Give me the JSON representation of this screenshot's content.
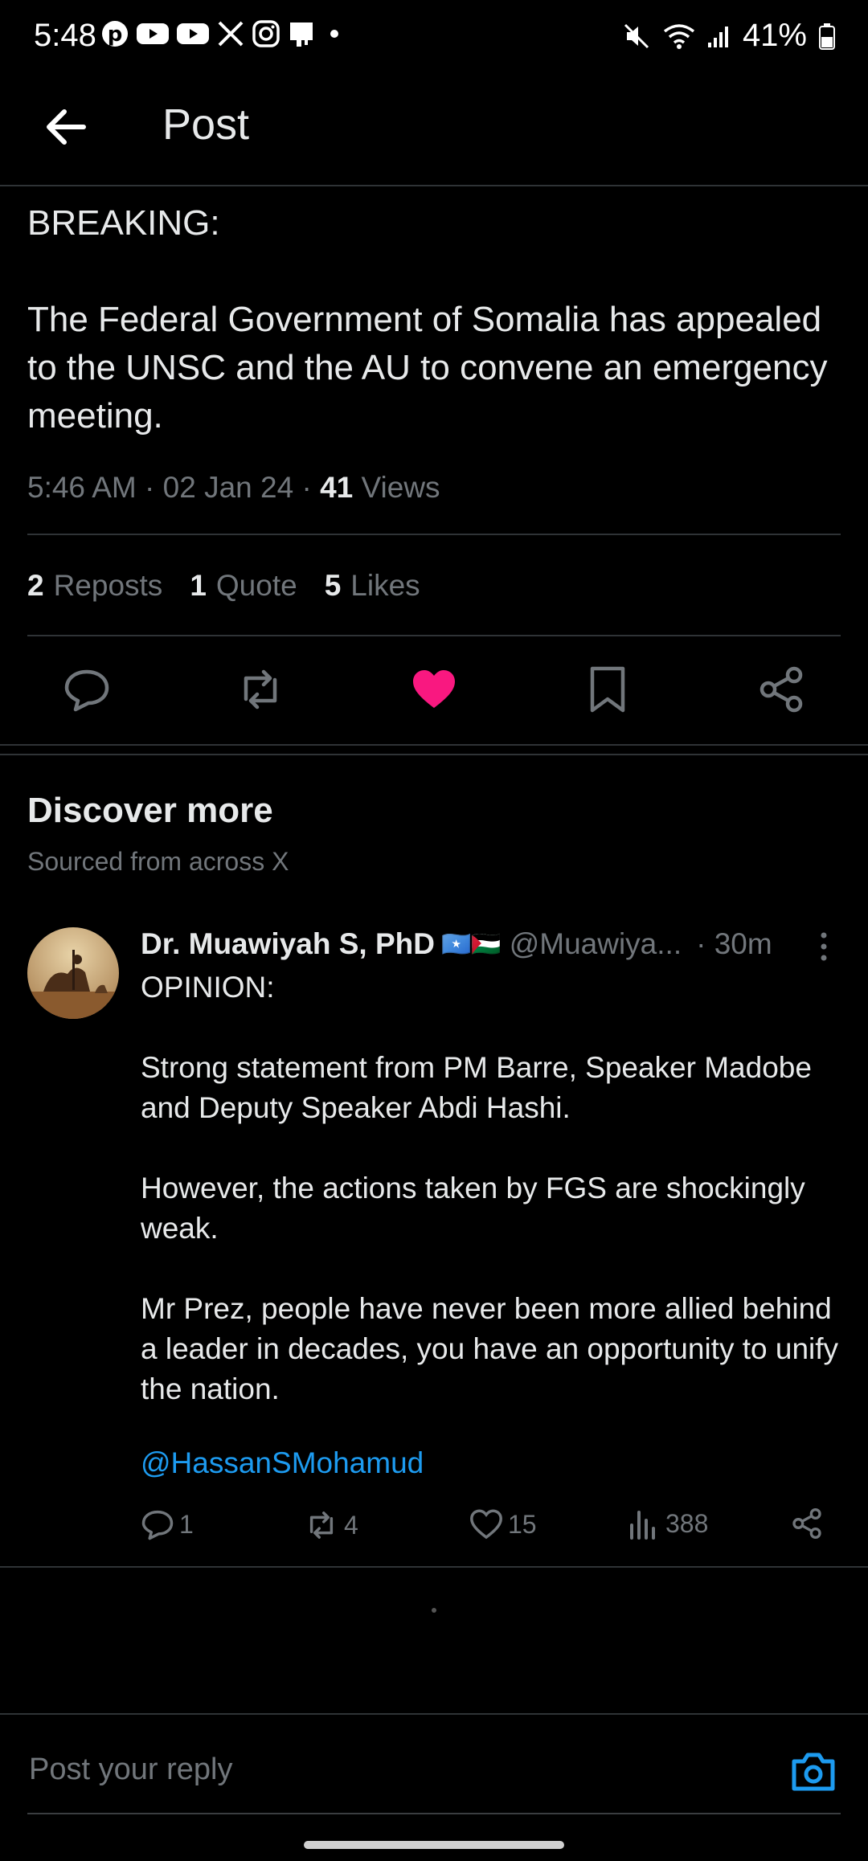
{
  "status_bar": {
    "time": "5:48",
    "battery": "41%",
    "app_icons": [
      "pinterest-icon",
      "youtube-icon",
      "youtube-icon",
      "x-icon",
      "instagram-icon",
      "screenshot-icon",
      "dot-icon"
    ]
  },
  "header": {
    "title": "Post"
  },
  "post": {
    "text": "BREAKING:\n\nThe Federal Government of Somalia has appealed to the UNSC and the AU to convene an emergency meeting.",
    "time": "5:46 AM",
    "date": "02 Jan 24",
    "views_count": "41",
    "views_label": "Views",
    "reposts_count": "2",
    "reposts_label": "Reposts",
    "quotes_count": "1",
    "quotes_label": "Quote",
    "likes_count": "5",
    "likes_label": "Likes",
    "liked": true
  },
  "colors": {
    "like": "#f91880",
    "link": "#1d9bf0",
    "muted": "#71767b",
    "text": "#e7e9ea",
    "divider": "#2f3336"
  },
  "discover": {
    "title": "Discover more",
    "subtitle": "Sourced from across X"
  },
  "tweet": {
    "name": "Dr. Muawiyah S, PhD",
    "flags": "🇸🇴🇵🇸",
    "handle": "@Muawiya...",
    "time": "· 30m",
    "body": "OPINION:\n\nStrong statement from PM Barre, Speaker Madobe and Deputy Speaker Abdi Hashi.\n\nHowever, the actions taken by FGS are shockingly weak.\n\nMr Prez, people have never been more allied behind a leader in decades, you have an opportunity to unify the nation.",
    "mention": "@HassanSMohamud",
    "replies": "1",
    "reposts": "4",
    "likes": "15",
    "views": "388"
  },
  "reply": {
    "placeholder": "Post your reply"
  }
}
